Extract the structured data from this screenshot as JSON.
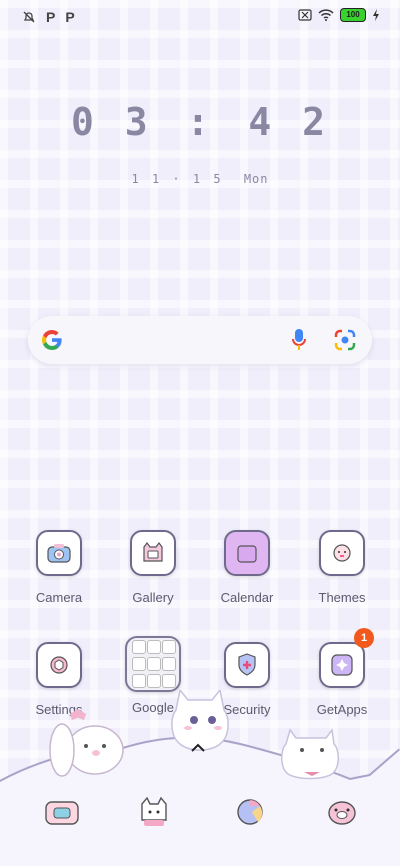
{
  "status": {
    "left_icons": [
      "notification-off-icon",
      "p-icon",
      "p-icon"
    ],
    "right_icons": [
      "sim-off-icon",
      "wifi-icon",
      "battery-icon",
      "charging-icon"
    ],
    "p_glyph": "P",
    "battery_level": "100"
  },
  "clock": {
    "h1": "0",
    "h2": "3",
    "sep": ":",
    "m1": "4",
    "m2": "2"
  },
  "date": {
    "day1": "1",
    "day2": "1",
    "dot": "·",
    "day3": "1",
    "day4": "5",
    "weekday": "Mon"
  },
  "apps_row1": [
    {
      "label": "Camera"
    },
    {
      "label": "Gallery"
    },
    {
      "label": "Calendar"
    },
    {
      "label": "Themes"
    }
  ],
  "apps_row2": [
    {
      "label": "Settings"
    },
    {
      "label": "Google"
    },
    {
      "label": "Security"
    },
    {
      "label": "GetApps",
      "badge": "1"
    }
  ],
  "dock_icons": [
    "phone-icon",
    "messages-icon",
    "browser-icon",
    "app-icon"
  ],
  "colors": {
    "accent_badge": "#f25a1d",
    "battery": "#39d12f",
    "background": "#efeefa"
  }
}
